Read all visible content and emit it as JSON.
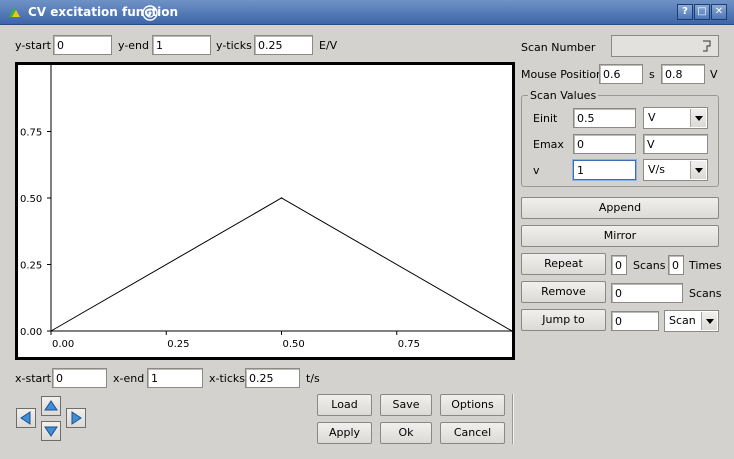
{
  "window": {
    "title": "CV excitation function",
    "help": "?",
    "maximize": "□",
    "close": "✕"
  },
  "y_axis_controls": {
    "start_label": "y-start",
    "start_value": "0",
    "end_label": "y-end",
    "end_value": "1",
    "ticks_label": "y-ticks",
    "ticks_value": "0.25",
    "unit": "E/V"
  },
  "x_axis_controls": {
    "start_label": "x-start",
    "start_value": "0",
    "end_label": "x-end",
    "end_value": "1",
    "ticks_label": "x-ticks",
    "ticks_value": "0.25",
    "unit": "t/s"
  },
  "scan_number": {
    "label": "Scan Number",
    "value": ""
  },
  "mouse_position": {
    "label": "Mouse Position",
    "x_value": "0.6",
    "x_unit": "s",
    "y_value": "0.8",
    "y_unit": "V"
  },
  "scan_values": {
    "title": "Scan Values",
    "einit_label": "Einit",
    "einit_value": "0.5",
    "einit_unit": "V",
    "emax_label": "Emax",
    "emax_value": "0",
    "emax_unit": "V",
    "v_label": "v",
    "v_value": "1",
    "v_unit": "V/s"
  },
  "actions": {
    "append": "Append",
    "mirror": "Mirror",
    "repeat": "Repeat",
    "repeat_scans_value": "0",
    "repeat_scans_label": "Scans",
    "repeat_times_value": "0",
    "repeat_times_label": "Times",
    "remove": "Remove",
    "remove_value": "0",
    "remove_label": "Scans",
    "jump_to": "Jump to",
    "jump_value": "0",
    "jump_unit": "Scan"
  },
  "buttons": {
    "load": "Load",
    "save": "Save",
    "options": "Options",
    "apply": "Apply",
    "ok": "Ok",
    "cancel": "Cancel"
  },
  "icons": {
    "left": "arrow-left-icon",
    "up": "arrow-up-icon",
    "down": "arrow-down-icon",
    "right": "arrow-right-icon"
  },
  "colors": {
    "titlebar": "#4a72b0",
    "arrow_fill": "#3f8fd6"
  },
  "chart_data": {
    "type": "line",
    "title": "",
    "xlabel": "",
    "ylabel": "",
    "xlim": [
      0,
      1
    ],
    "ylim": [
      0,
      1
    ],
    "x_ticks": [
      "0.00",
      "0.25",
      "0.50",
      "0.75"
    ],
    "y_ticks": [
      "0.00",
      "0.25",
      "0.50",
      "0.75"
    ],
    "grid": false,
    "series": [
      {
        "x": [
          0,
          0.5,
          1
        ],
        "y": [
          0,
          0.5,
          0
        ]
      }
    ]
  }
}
